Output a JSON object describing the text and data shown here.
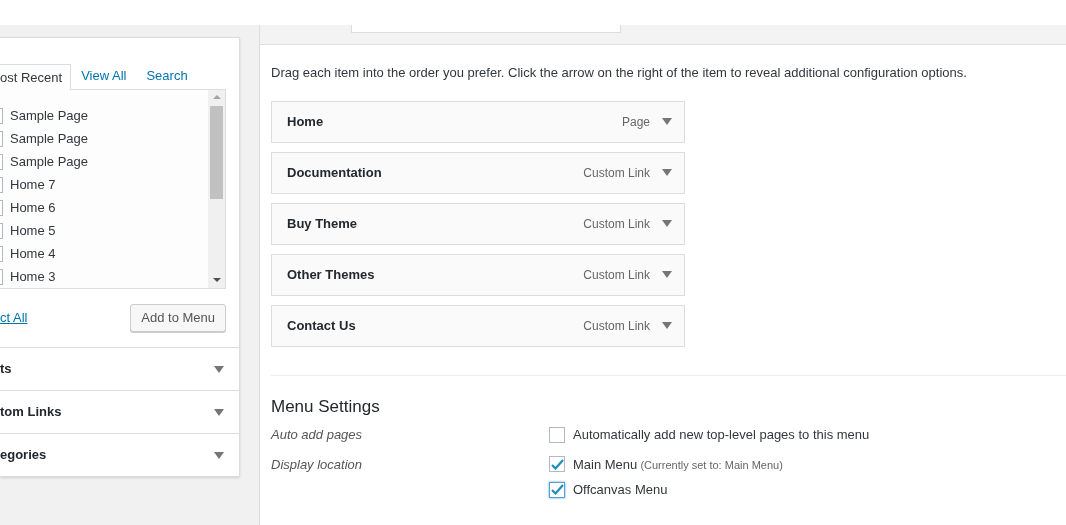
{
  "side_panel": {
    "tabs": [
      {
        "label": "ost Recent",
        "selected": true
      },
      {
        "label": "View All",
        "selected": false
      },
      {
        "label": "Search",
        "selected": false
      }
    ],
    "items": [
      {
        "label": "Sample Page",
        "checked": false
      },
      {
        "label": "Sample Page",
        "checked": false
      },
      {
        "label": "Sample Page",
        "checked": false
      },
      {
        "label": "Home 7",
        "checked": false
      },
      {
        "label": "Home 6",
        "checked": false
      },
      {
        "label": "Home 5",
        "checked": false
      },
      {
        "label": "Home 4",
        "checked": false
      },
      {
        "label": "Home 3",
        "checked": false
      }
    ],
    "select_all": "ct All",
    "add_button": "Add to Menu",
    "sections": [
      {
        "label": "ts",
        "expanded": false
      },
      {
        "label": "tom Links",
        "expanded": false
      },
      {
        "label": "egories",
        "expanded": false
      }
    ]
  },
  "menu": {
    "instructions": "Drag each item into the order you prefer. Click the arrow on the right of the item to reveal additional configuration options.",
    "items": [
      {
        "title": "Home",
        "type": "Page"
      },
      {
        "title": "Documentation",
        "type": "Custom Link"
      },
      {
        "title": "Buy Theme",
        "type": "Custom Link"
      },
      {
        "title": "Other Themes",
        "type": "Custom Link"
      },
      {
        "title": "Contact Us",
        "type": "Custom Link"
      }
    ]
  },
  "settings": {
    "heading": "Menu Settings",
    "rows": [
      {
        "label": "Auto add pages",
        "options": [
          {
            "label": "Automatically add new top-level pages to this menu",
            "checked": false
          }
        ]
      },
      {
        "label": "Display location",
        "options": [
          {
            "label": "Main Menu",
            "note": "(Currently set to: Main Menu)",
            "checked": true,
            "focused": false
          },
          {
            "label": "Offcanvas Menu",
            "checked": true,
            "focused": true
          }
        ]
      }
    ]
  }
}
